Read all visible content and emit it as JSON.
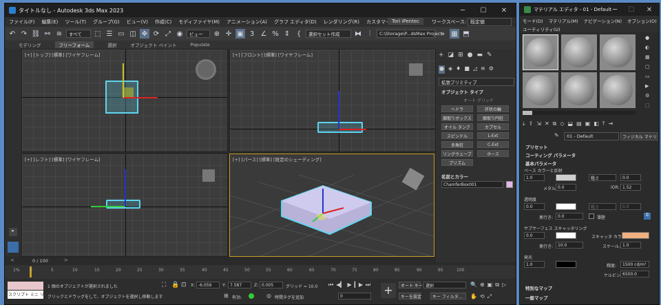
{
  "main_window": {
    "title": "タイトルなし - Autodesk 3ds Max 2023",
    "menus": [
      "ファイル(F)",
      "編集(E)",
      "ツール(T)",
      "グループ(G)",
      "ビュー(V)",
      "作成(C)",
      "モディファイヤ(M)",
      "アニメーション(A)",
      "グラフ エディタ(D)",
      "レンダリング(R)",
      "カスタマイズ(U)"
    ],
    "user": "Tori iPentec",
    "workspace_label": "ワークスペース:",
    "workspace_value": "既定値",
    "selection_filter": "すべて",
    "ref_coord": "ビュー",
    "selection_set": "選択セット作成",
    "project_path": "C:\\Storage\\P...dsMax Project",
    "ribbon_tabs": [
      "モデリング",
      "フリーフォーム",
      "選択",
      "オブジェクト ペイント",
      "Populate"
    ],
    "viewports": {
      "top": "[+] [トップ] [標準] [ワイヤフレーム]",
      "front": "[+] [フロント] [標準] [ワイヤフレーム]",
      "left": "[+] [レフト] [標準] [ワイヤフレーム]",
      "persp": "[+] [パース] [標準] [既定のシェーディング]"
    },
    "command_panel": {
      "category": "拡張プリミティブ",
      "object_type_title": "オブジェクト タイプ",
      "autogrid": "オート グリッド",
      "buttons": [
        "ヘドラ",
        "环状の輪",
        "面取りボックス",
        "面取り円柱",
        "オイル タンク",
        "カプセル",
        "スピンドル",
        "L-Ext",
        "多角柱",
        "C-Ext",
        "リングウェーブ",
        "ホース",
        "プリズム"
      ],
      "name_color_title": "名前とカラー",
      "object_name": "ChamferBox001"
    },
    "timeline": {
      "frame_display": "0 / 100",
      "ticks": [
        "0",
        "5",
        "10",
        "15",
        "20",
        "25",
        "30",
        "35",
        "40",
        "45",
        "50",
        "55",
        "60",
        "65",
        "70",
        "75",
        "80",
        "85",
        "90",
        "95",
        "100"
      ]
    },
    "status": {
      "script": "スクリプト ミニ リス",
      "message1": "1 個のオブジェクトが選択されました",
      "message2": "クリックとドラッグをして、オブジェクトを選択し移動します",
      "x_label": "X:",
      "x": "-6.059",
      "y_label": "Y:",
      "y": "7.587",
      "z_label": "Z:",
      "z": "0.005",
      "grid": "グリッド = 10.0",
      "enabled": "有効:",
      "add_time_tag": "時間タグを追加",
      "auto_key": "オート キー",
      "set_key": "キーを設定",
      "selected": "選択",
      "key_filters": "キー フィルタ...",
      "frame": "0"
    }
  },
  "material_editor": {
    "title": "マテリアル エディタ - 01 - Default",
    "menus": [
      "モード(D)",
      "マテリアル(M)",
      "ナビゲーション(N)",
      "オプション(O)",
      "ユーティリティ(U)"
    ],
    "material_name": "01 - Default",
    "material_type": "フィジカル マテリアル",
    "rollouts": {
      "presets": "プリセット",
      "coating": "コーティング パラメータ",
      "basic": "基本パラメータ",
      "special_maps": "特別なマップ",
      "general_maps": "一般マップ"
    },
    "base": {
      "title": "ベース カラーと反射",
      "weight": "1.0",
      "rough_mode": "粗さ",
      "rough": "0.0",
      "metal_label": "メタル:",
      "metal": "0.0",
      "ior_label": "IOR:",
      "ior": "1.52"
    },
    "transparency": {
      "title": "透明度",
      "weight": "0.0",
      "mode": "粗さ",
      "depth_label": "奥行き:",
      "depth": "0.0",
      "thin_label": "薄壁",
      "rough": "0.0"
    },
    "sss": {
      "title": "サブサーフェス スキャッタリング",
      "weight": "0.0",
      "depth_label": "奥行き:",
      "depth": "10.0",
      "scatter_color_label": "スキャッタ カラー:",
      "scale_label": "スケール:",
      "scale": "1.0"
    },
    "emission": {
      "title": "発光",
      "weight": "1.0",
      "lum_label": "輝度:",
      "lum": "1500 cd/m²",
      "kelvin_label": "ケルビン:",
      "kelvin": "6500.0"
    }
  },
  "colors": {
    "accent": "#5fd5f0",
    "selection_yellow": "#c8a020",
    "desktop": "#5a8bc4",
    "base_color": "#cfcfcf",
    "scatter_color": "#f0b080",
    "object_color": "#e0b8e8"
  }
}
